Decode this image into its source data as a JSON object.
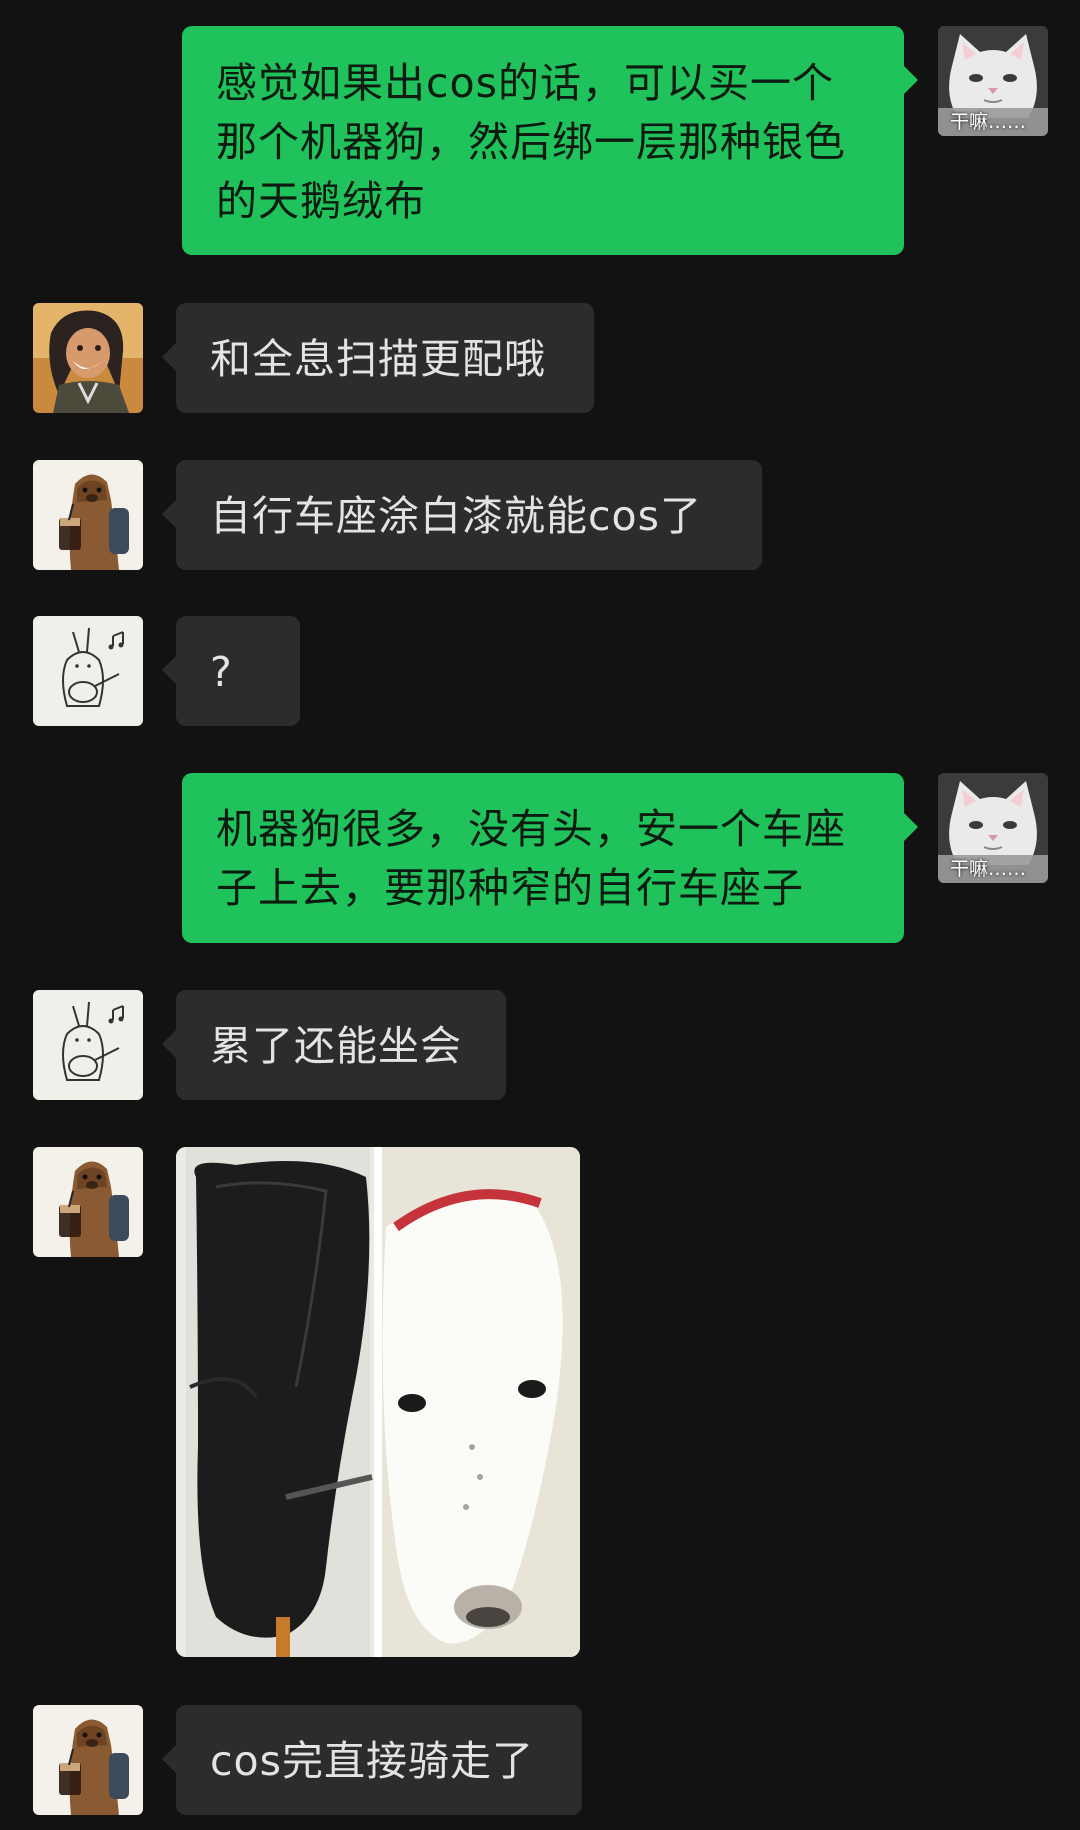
{
  "messages": [
    {
      "sender": "self",
      "avatar": "cat-avatar",
      "text": "感觉如果出cos的话，可以买一个那个机器狗，然后绑一层那种银色的天鹅绒布"
    },
    {
      "sender": "other",
      "avatar": "woman-avatar",
      "text": "和全息扫描更配哦"
    },
    {
      "sender": "other",
      "avatar": "otter-avatar",
      "text": "自行车座涂白漆就能cos了"
    },
    {
      "sender": "other",
      "avatar": "rabbit-avatar",
      "text": "?"
    },
    {
      "sender": "self",
      "avatar": "cat-avatar",
      "text": "机器狗很多，没有头，安一个车座子上去，要那种窄的自行车座子"
    },
    {
      "sender": "other",
      "avatar": "rabbit-avatar",
      "text": "累了还能坐会"
    },
    {
      "sender": "other",
      "avatar": "otter-avatar",
      "image": "bike-seat-vs-dog-head-photo"
    },
    {
      "sender": "other",
      "avatar": "otter-avatar",
      "text": "cos完直接骑走了"
    }
  ],
  "cat_avatar_caption": "干嘛……",
  "colors": {
    "background": "#121212",
    "incoming_bubble": "#2c2c2c",
    "outgoing_bubble": "#1fc25b",
    "incoming_text": "#e3e3e3",
    "outgoing_text": "#0d1a10"
  }
}
